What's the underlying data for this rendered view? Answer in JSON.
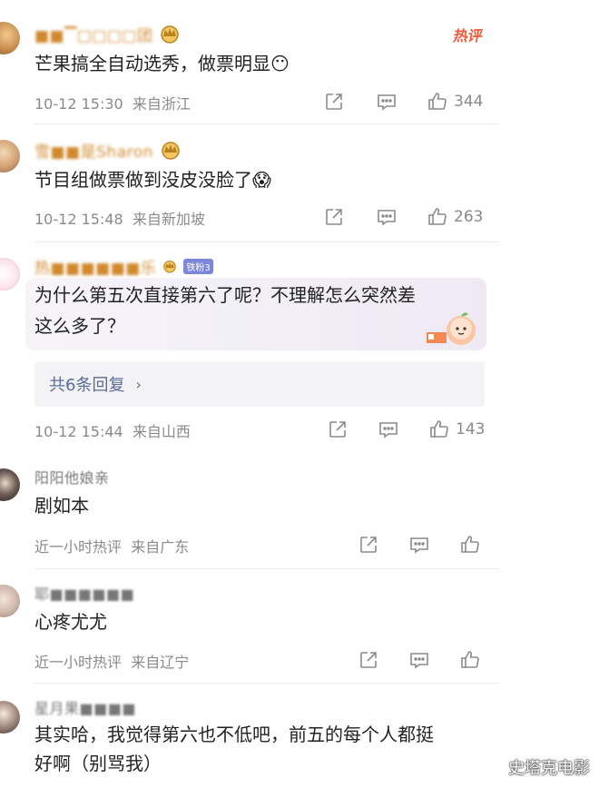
{
  "hot_badge": "热评",
  "replies_label": "共6条回复",
  "watermark": "史塔克电影",
  "icons": {
    "share": "share-icon",
    "reply": "comment-icon",
    "like": "thumbs-up-icon"
  },
  "colors": {
    "username_gold": "#d08a2e",
    "meta_gray": "#8a8a8a",
    "hot_red": "#ef5a3a",
    "link_blue": "#5b6b99"
  },
  "comments": [
    {
      "username": "■■▔□□□□团",
      "text": "芒果搞全自动选秀，做票明显😶",
      "time": "10-12 15:30",
      "location": "来自浙江",
      "likes": "344"
    },
    {
      "username": "雪■■是Sharon",
      "text": "节目组做票做到没皮没脸了😱",
      "time": "10-12 15:48",
      "location": "来自新加坡",
      "likes": "263"
    },
    {
      "username": "热■■■■■■乐",
      "fan_badge": "铁粉3",
      "text_line1": "为什么第五次直接第六了呢？不理解怎么突然差",
      "text_line2": "这么多了？",
      "time": "10-12 15:44",
      "location": "来自山西",
      "likes": "143"
    },
    {
      "username": "阳阳他娘亲",
      "text": "剧如本",
      "time": "近一小时热评",
      "location": "来自广东",
      "likes": ""
    },
    {
      "username": "耶■■■■■■",
      "text": "心疼尤尤",
      "time": "近一小时热评",
      "location": "来自辽宁",
      "likes": ""
    },
    {
      "username": "星月果■■■■",
      "text_line1": "其实哈，我觉得第六也不低吧，前五的每个人都挺",
      "text_line2": "好啊（别骂我）"
    }
  ]
}
